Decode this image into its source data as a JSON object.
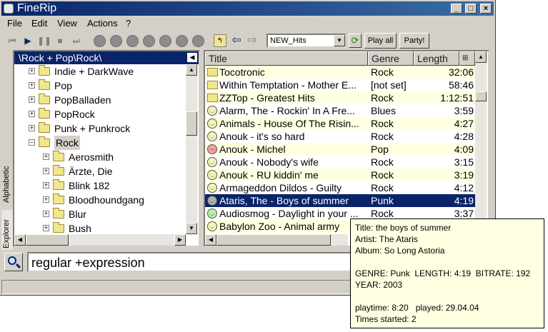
{
  "window": {
    "title": "FineRip",
    "minimize_icon": "minimize-icon",
    "maximize_icon": "maximize-icon",
    "close_icon": "close-icon"
  },
  "menu": [
    "File",
    "Edit",
    "View",
    "Actions",
    "?"
  ],
  "toolbar": {
    "playlist_value": "NEW_Hits",
    "play_all_label": "Play all",
    "party_label": "Party!"
  },
  "side_tabs": {
    "explorer": "Explorer",
    "alphabetic": "Alphabetic"
  },
  "tree": {
    "path": "\\Rock + Pop\\Rock\\",
    "items": [
      {
        "label": "Indie + DarkWave",
        "expander": "+",
        "level": 1,
        "selected": false
      },
      {
        "label": "Pop",
        "expander": "+",
        "level": 1,
        "selected": false
      },
      {
        "label": "PopBalladen",
        "expander": "+",
        "level": 1,
        "selected": false
      },
      {
        "label": "PopRock",
        "expander": "+",
        "level": 1,
        "selected": false
      },
      {
        "label": "Punk + Punkrock",
        "expander": "+",
        "level": 1,
        "selected": false
      },
      {
        "label": "Rock",
        "expander": "−",
        "level": 1,
        "selected": true
      },
      {
        "label": "Aerosmith",
        "expander": "+",
        "level": 2,
        "selected": false
      },
      {
        "label": "Ärzte, Die",
        "expander": "+",
        "level": 2,
        "selected": false
      },
      {
        "label": "Blink 182",
        "expander": "+",
        "level": 2,
        "selected": false
      },
      {
        "label": "Bloodhoundgang",
        "expander": "+",
        "level": 2,
        "selected": false
      },
      {
        "label": "Blur",
        "expander": "+",
        "level": 2,
        "selected": false
      },
      {
        "label": "Bush",
        "expander": "+",
        "level": 2,
        "selected": false
      }
    ]
  },
  "list": {
    "columns": [
      "Title",
      "Genre",
      "Length"
    ],
    "rows": [
      {
        "icon": "folder",
        "title": "Tocotronic",
        "genre": "Rock",
        "length": "32:06"
      },
      {
        "icon": "folder",
        "title": "Within Temptation - Mother E...",
        "genre": "[not set]",
        "length": "58:46"
      },
      {
        "icon": "folder",
        "title": "ZZTop - Greatest Hits",
        "genre": "Rock",
        "length": "1:12:51"
      },
      {
        "icon": "neutral",
        "title": "Alarm, The - Rockin' In A Fre...",
        "genre": "Blues",
        "length": "3:59"
      },
      {
        "icon": "neutral",
        "title": "Animals - House Of The Risin...",
        "genre": "Rock",
        "length": "4:27"
      },
      {
        "icon": "neutral",
        "title": "Anouk - it's so hard",
        "genre": "Rock",
        "length": "4:28"
      },
      {
        "icon": "sad",
        "title": "Anouk - Michel",
        "genre": "Pop",
        "length": "4:09"
      },
      {
        "icon": "neutral",
        "title": "Anouk - Nobody's wife",
        "genre": "Rock",
        "length": "3:15"
      },
      {
        "icon": "neutral",
        "title": "Anouk - RU kiddin' me",
        "genre": "Rock",
        "length": "3:19"
      },
      {
        "icon": "neutral",
        "title": "Armageddon Dildos - Guilty",
        "genre": "Rock",
        "length": "4:12"
      },
      {
        "icon": "playing",
        "title": "Ataris, The - Boys of summer",
        "genre": "Punk",
        "length": "4:19",
        "selected": true
      },
      {
        "icon": "happy",
        "title": "Audiosmog - Daylight in your ...",
        "genre": "Rock",
        "length": "3:37"
      },
      {
        "icon": "neutral",
        "title": "Babylon Zoo - Animal army",
        "genre": "",
        "length": ""
      }
    ]
  },
  "search": {
    "value": "regular +expression"
  },
  "tooltip": {
    "title": "Title: the boys of summer",
    "artist": "Artist: The Ataris",
    "album": "Album: So Long Astoria",
    "genre_line": "GENRE: Punk  LENGTH: 4:19  BITRATE: 192",
    "year": "YEAR: 2003",
    "playtime_line": "playtime: 8:20   played: 29.04.04",
    "times_started": "Times started: 2"
  },
  "colors": {
    "selection": "#0a246a",
    "row_alt": "#ffffe1",
    "chrome": "#d4d0c8"
  }
}
